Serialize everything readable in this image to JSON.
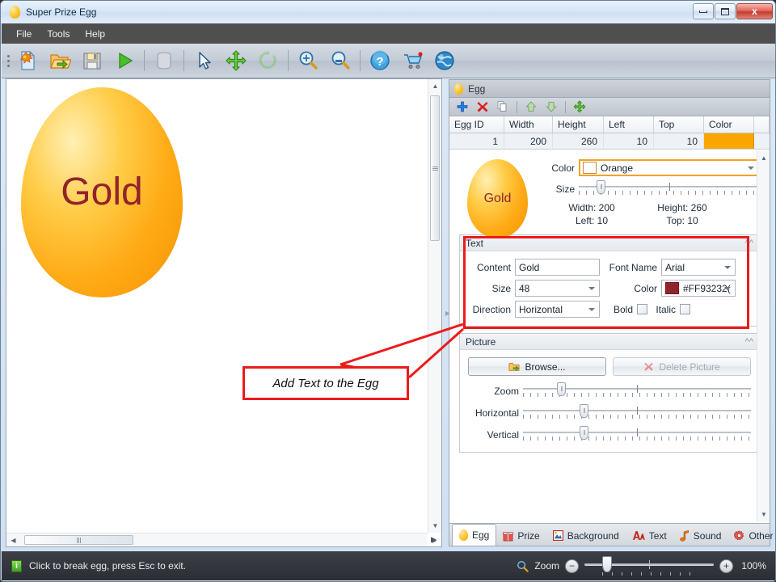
{
  "window": {
    "title": "Super Prize Egg",
    "minimize_label": "Minimize",
    "maximize_label": "Maximize",
    "close_label": "x"
  },
  "menu": {
    "items": [
      {
        "label": "File"
      },
      {
        "label": "Tools"
      },
      {
        "label": "Help"
      }
    ]
  },
  "toolbar": {
    "buttons": [
      {
        "name": "new-icon",
        "tooltip": "New"
      },
      {
        "name": "open-icon",
        "tooltip": "Open"
      },
      {
        "name": "save-icon",
        "tooltip": "Save"
      },
      {
        "name": "run-icon",
        "tooltip": "Run"
      },
      {
        "name": "database-icon",
        "tooltip": "Database"
      },
      {
        "name": "select-cursor-icon",
        "tooltip": "Select"
      },
      {
        "name": "move-icon",
        "tooltip": "Move"
      },
      {
        "name": "rotate-icon",
        "tooltip": "Rotate"
      },
      {
        "name": "zoom-in-icon",
        "tooltip": "Zoom In"
      },
      {
        "name": "zoom-fit-icon",
        "tooltip": "Zoom Fit"
      },
      {
        "name": "help-icon",
        "tooltip": "Help"
      },
      {
        "name": "cart-icon",
        "tooltip": "Buy"
      },
      {
        "name": "globe-icon",
        "tooltip": "Website"
      }
    ]
  },
  "canvas": {
    "egg_label": "Gold",
    "egg_color_hex": "#F9A602",
    "egg_text_color_hex": "#93232B"
  },
  "panel": {
    "header_title": "Egg",
    "tools": [
      {
        "name": "add-icon",
        "label": "Add"
      },
      {
        "name": "delete-icon",
        "label": "Delete"
      },
      {
        "name": "copy-icon",
        "label": "Copy"
      },
      {
        "name": "move-up-icon",
        "label": "Move Up"
      },
      {
        "name": "move-down-icon",
        "label": "Move Down"
      },
      {
        "name": "arrange-icon",
        "label": "Arrange"
      }
    ],
    "grid": {
      "columns": [
        "Egg ID",
        "Width",
        "Height",
        "Left",
        "Top",
        "Color"
      ],
      "rows": [
        {
          "egg_id": "1",
          "width": "200",
          "height": "260",
          "left": "10",
          "top": "10",
          "color": "#F9A602"
        }
      ]
    },
    "egg_section": {
      "thumb_label": "Gold",
      "color_label": "Color",
      "color_value": "Orange",
      "color_swatch": "#F9A602",
      "size_label": "Size",
      "width_text": "Width: 200",
      "height_text": "Height: 260",
      "left_text": "Left: 10",
      "top_text": "Top: 10"
    },
    "text_section": {
      "title": "Text",
      "content_label": "Content",
      "content_value": "Gold",
      "font_name_label": "Font Name",
      "font_name_value": "Arial",
      "size_label": "Size",
      "size_value": "48",
      "color_label": "Color",
      "color_value": "#FF93232(",
      "color_swatch": "#93232B",
      "direction_label": "Direction",
      "direction_value": "Horizontal",
      "bold_label": "Bold",
      "italic_label": "Italic"
    },
    "picture_section": {
      "title": "Picture",
      "browse_label": "Browse...",
      "delete_label": "Delete Picture",
      "zoom_label": "Zoom",
      "horizontal_label": "Horizontal",
      "vertical_label": "Vertical"
    },
    "tabs": [
      {
        "label": "Egg",
        "icon": "egg-icon",
        "active": true
      },
      {
        "label": "Prize",
        "icon": "gift-icon",
        "active": false
      },
      {
        "label": "Background",
        "icon": "image-icon",
        "active": false
      },
      {
        "label": "Text",
        "icon": "font-icon",
        "active": false
      },
      {
        "label": "Sound",
        "icon": "note-icon",
        "active": false
      },
      {
        "label": "Other",
        "icon": "gear-icon",
        "active": false
      }
    ]
  },
  "statusbar": {
    "info_icon": "i",
    "message": "Click to break egg, press Esc to exit.",
    "zoom_label": "Zoom",
    "zoom_out_label": "−",
    "zoom_in_label": "+",
    "zoom_percent": "100%"
  },
  "annotation": {
    "callout_text": "Add Text to the Egg",
    "color": "#EC1B1B"
  }
}
